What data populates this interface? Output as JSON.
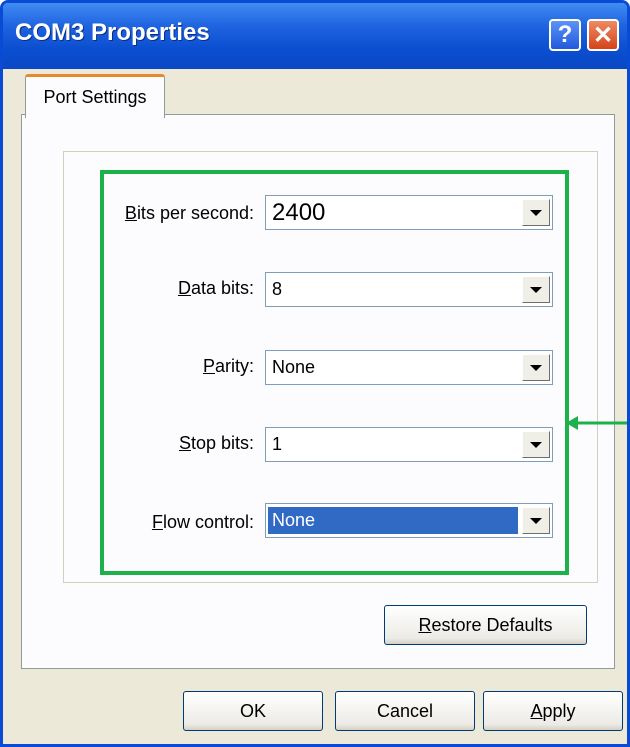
{
  "window": {
    "title": "COM3 Properties"
  },
  "titlebar": {
    "help_label": "?",
    "close_label": "✕"
  },
  "tabs": [
    {
      "label": "Port Settings",
      "active": true
    }
  ],
  "settings": {
    "bits_per_second": {
      "label_mnemonic": "B",
      "label_rest": "its per second:",
      "value": "2400"
    },
    "data_bits": {
      "label_mnemonic": "D",
      "label_rest": "ata bits:",
      "value": "8"
    },
    "parity": {
      "label_pre": "",
      "label_mnemonic": "P",
      "label_rest": "arity:",
      "value": "None"
    },
    "stop_bits": {
      "label_mnemonic": "S",
      "label_rest": "top bits:",
      "value": "1"
    },
    "flow_control": {
      "label_mnemonic": "F",
      "label_rest": "low control:",
      "value": "None",
      "selected": true
    }
  },
  "buttons": {
    "restore_mnemonic": "R",
    "restore_rest": "estore Defaults",
    "ok": "OK",
    "cancel": "Cancel",
    "apply_mnemonic": "A",
    "apply_rest": "pply"
  },
  "colors": {
    "highlight_border": "#1db14b",
    "titlebar": "#0b4fd1",
    "selection": "#316ac5"
  }
}
